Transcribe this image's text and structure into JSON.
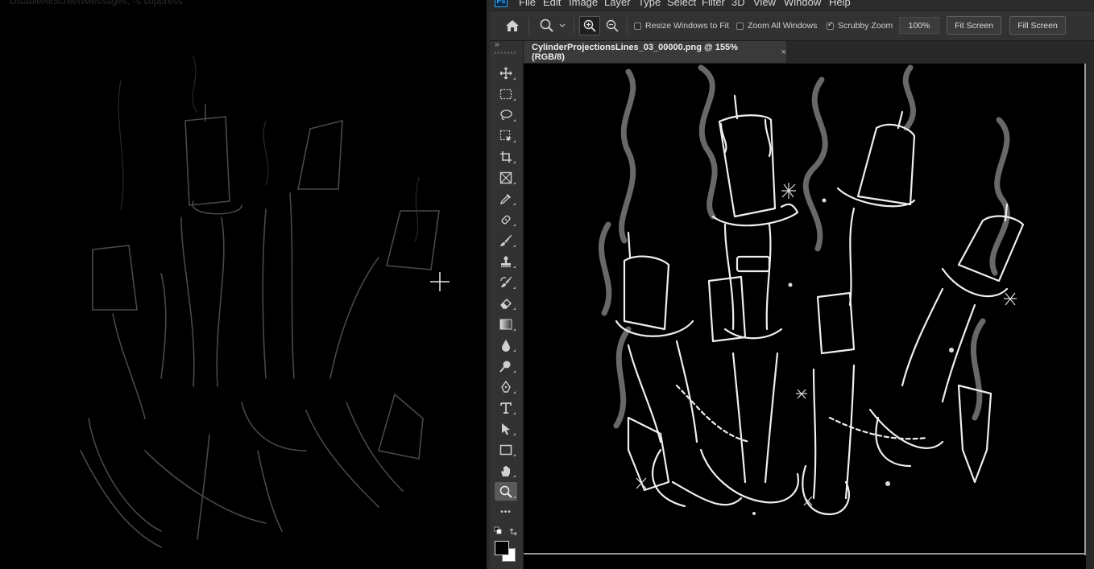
{
  "left_panel": {
    "caption": "DisableAllScreenMessages; -s suppress"
  },
  "menu": {
    "logo": "Ps",
    "items": [
      "File",
      "Edit",
      "Image",
      "Layer",
      "Type",
      "Select",
      "Filter",
      "3D",
      "View",
      "Window",
      "Help"
    ]
  },
  "options": {
    "resize_windows": {
      "label": "Resize Windows to Fit",
      "checked": false
    },
    "zoom_all": {
      "label": "Zoom All Windows",
      "checked": false
    },
    "scrubby": {
      "label": "Scrubby Zoom",
      "checked": true
    },
    "zoom_value": "100%",
    "fit_screen": "Fit Screen",
    "fill_screen": "Fill Screen"
  },
  "toolbar": {
    "collapse": "››",
    "active_tool": "zoom-tool",
    "tools": [
      "move-tool",
      "marquee-tool",
      "lasso-tool",
      "object-select-tool",
      "crop-tool",
      "frame-tool",
      "eyedropper-tool",
      "healing-brush-tool",
      "brush-tool",
      "clone-stamp-tool",
      "history-brush-tool",
      "eraser-tool",
      "gradient-tool",
      "blur-tool",
      "dodge-tool",
      "pen-tool",
      "type-tool",
      "path-select-tool",
      "rectangle-tool",
      "hand-tool",
      "zoom-tool"
    ],
    "more": "•••",
    "colors": {
      "foreground": "#000000",
      "background": "#ffffff"
    }
  },
  "document": {
    "tab_title": "CylinderProjectionsLines_03_00000.png @ 155% (RGB/8)",
    "close": "×"
  },
  "colors": {
    "panel": "#323232",
    "accent": "#31a8ff"
  }
}
